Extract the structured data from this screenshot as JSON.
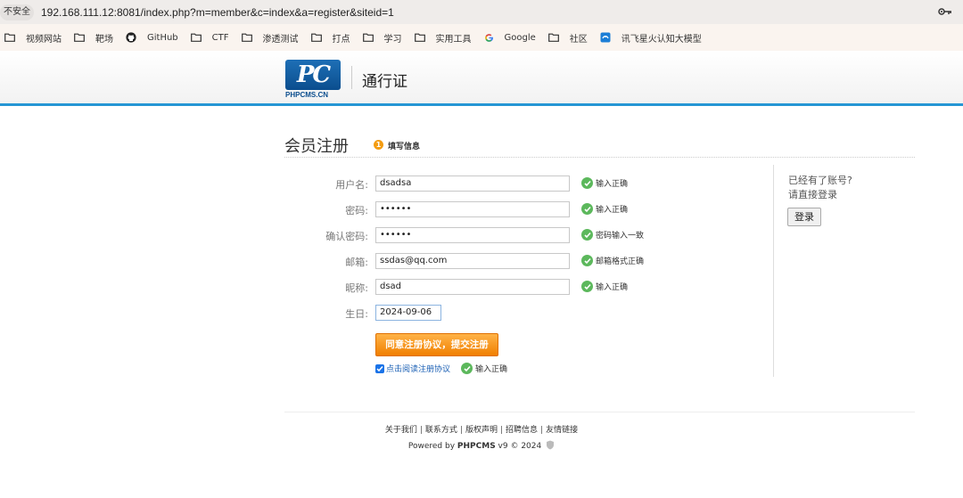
{
  "browser": {
    "insecure_label": "不安全",
    "url": "192.168.111.12:8081/index.php?m=member&c=index&a=register&siteid=1",
    "bookmarks": [
      {
        "label": "视频网站",
        "icon": "folder-icon"
      },
      {
        "label": "靶场",
        "icon": "folder-icon"
      },
      {
        "label": "GitHub",
        "icon": "github-icon"
      },
      {
        "label": "CTF",
        "icon": "folder-icon"
      },
      {
        "label": "渗透测试",
        "icon": "folder-icon"
      },
      {
        "label": "打点",
        "icon": "folder-icon"
      },
      {
        "label": "学习",
        "icon": "folder-icon"
      },
      {
        "label": "实用工具",
        "icon": "folder-icon"
      },
      {
        "label": "Google",
        "icon": "google-icon"
      },
      {
        "label": "社区",
        "icon": "folder-icon"
      },
      {
        "label": "讯飞星火认知大模型",
        "icon": "spark-icon"
      }
    ]
  },
  "header": {
    "logo_letters": "PC",
    "logo_text": "PHPCMS.CN",
    "title": "通行证"
  },
  "page": {
    "title": "会员注册",
    "step_number": "1",
    "step_label": "填写信息"
  },
  "form": {
    "fields": [
      {
        "label": "用户名:",
        "value": "dsadsa",
        "status": "输入正确"
      },
      {
        "label": "密码:",
        "value": "••••••",
        "status": "输入正确"
      },
      {
        "label": "确认密码:",
        "value": "••••••",
        "status": "密码输入一致"
      },
      {
        "label": "邮箱:",
        "value": "ssdas@qq.com",
        "status": "邮箱格式正确"
      },
      {
        "label": "昵称:",
        "value": "dsad",
        "status": "输入正确"
      },
      {
        "label": "生日:",
        "value": "2024-09-06"
      }
    ],
    "submit_label": "同意注册协议，提交注册",
    "agree_label": "点击阅读注册协议",
    "agree_checked": true,
    "agree_status": "输入正确"
  },
  "side": {
    "line1": "已经有了账号?",
    "line2": "请直接登录",
    "login_label": "登录"
  },
  "footer": {
    "links": [
      "关于我们",
      "联系方式",
      "版权声明",
      "招聘信息",
      "友情链接"
    ],
    "powered_prefix": "Powered by ",
    "powered_brand": "PHPCMS",
    "powered_suffix": " v9 © 2024"
  },
  "colors": {
    "accent_blue": "#2596d4",
    "success_green": "#5cb85c",
    "submit_orange": "#f07f00"
  }
}
